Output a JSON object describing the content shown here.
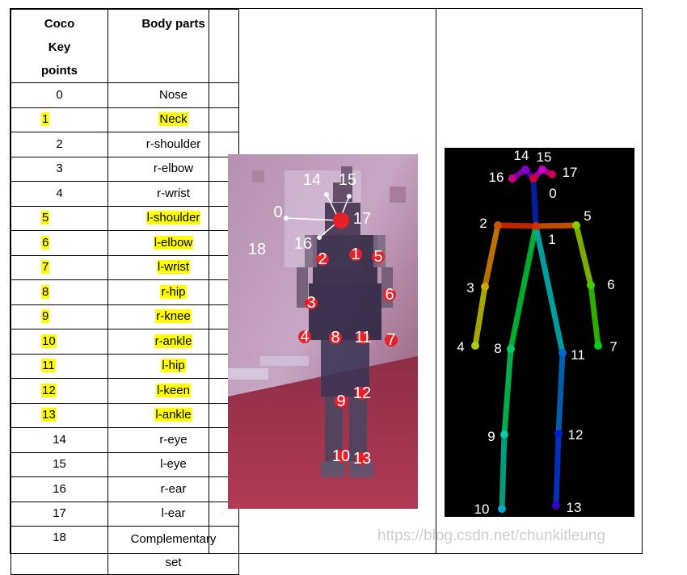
{
  "table": {
    "header_keypoints": [
      "Coco",
      "Key",
      "points"
    ],
    "header_bodyparts": "Body parts",
    "rows": [
      {
        "id": "0",
        "part": "Nose",
        "highlight": false
      },
      {
        "id": "1",
        "part": "Neck",
        "highlight": true
      },
      {
        "id": "2",
        "part": "r-shoulder",
        "highlight": false
      },
      {
        "id": "3",
        "part": "r-elbow",
        "highlight": false
      },
      {
        "id": "4",
        "part": "r-wrist",
        "highlight": false
      },
      {
        "id": "5",
        "part": "l-shoulder",
        "highlight": true
      },
      {
        "id": "6",
        "part": "l-elbow",
        "highlight": true
      },
      {
        "id": "7",
        "part": "l-wrist",
        "highlight": true
      },
      {
        "id": "8",
        "part": "r-hip",
        "highlight": true
      },
      {
        "id": "9",
        "part": "r-knee",
        "highlight": true
      },
      {
        "id": "10",
        "part": "r-ankle",
        "highlight": true
      },
      {
        "id": "11",
        "part": "l-hip",
        "highlight": true
      },
      {
        "id": "12",
        "part": "l-keen",
        "highlight": true
      },
      {
        "id": "13",
        "part": "l-ankle",
        "highlight": true
      },
      {
        "id": "14",
        "part": "r-eye",
        "highlight": false
      },
      {
        "id": "15",
        "part": "l-eye",
        "highlight": false
      },
      {
        "id": "16",
        "part": "r-ear",
        "highlight": false
      },
      {
        "id": "17",
        "part": "l-ear",
        "highlight": false
      },
      {
        "id": "18",
        "part": "Complementary set",
        "highlight": false
      }
    ]
  },
  "photo_labels": [
    "0",
    "1",
    "2",
    "3",
    "4",
    "5",
    "6",
    "7",
    "8",
    "9",
    "10",
    "11",
    "12",
    "13",
    "14",
    "15",
    "16",
    "17",
    "18"
  ],
  "skeleton_labels": [
    "0",
    "1",
    "2",
    "3",
    "4",
    "5",
    "6",
    "7",
    "8",
    "9",
    "10",
    "11",
    "12",
    "13",
    "14",
    "15",
    "16",
    "17"
  ],
  "watermark": "https://blog.csdn.net/chunkitleung",
  "colors": {
    "highlight": "#ffff00",
    "photo_marker": "#e8202a",
    "skeleton_bg": "#000000"
  }
}
